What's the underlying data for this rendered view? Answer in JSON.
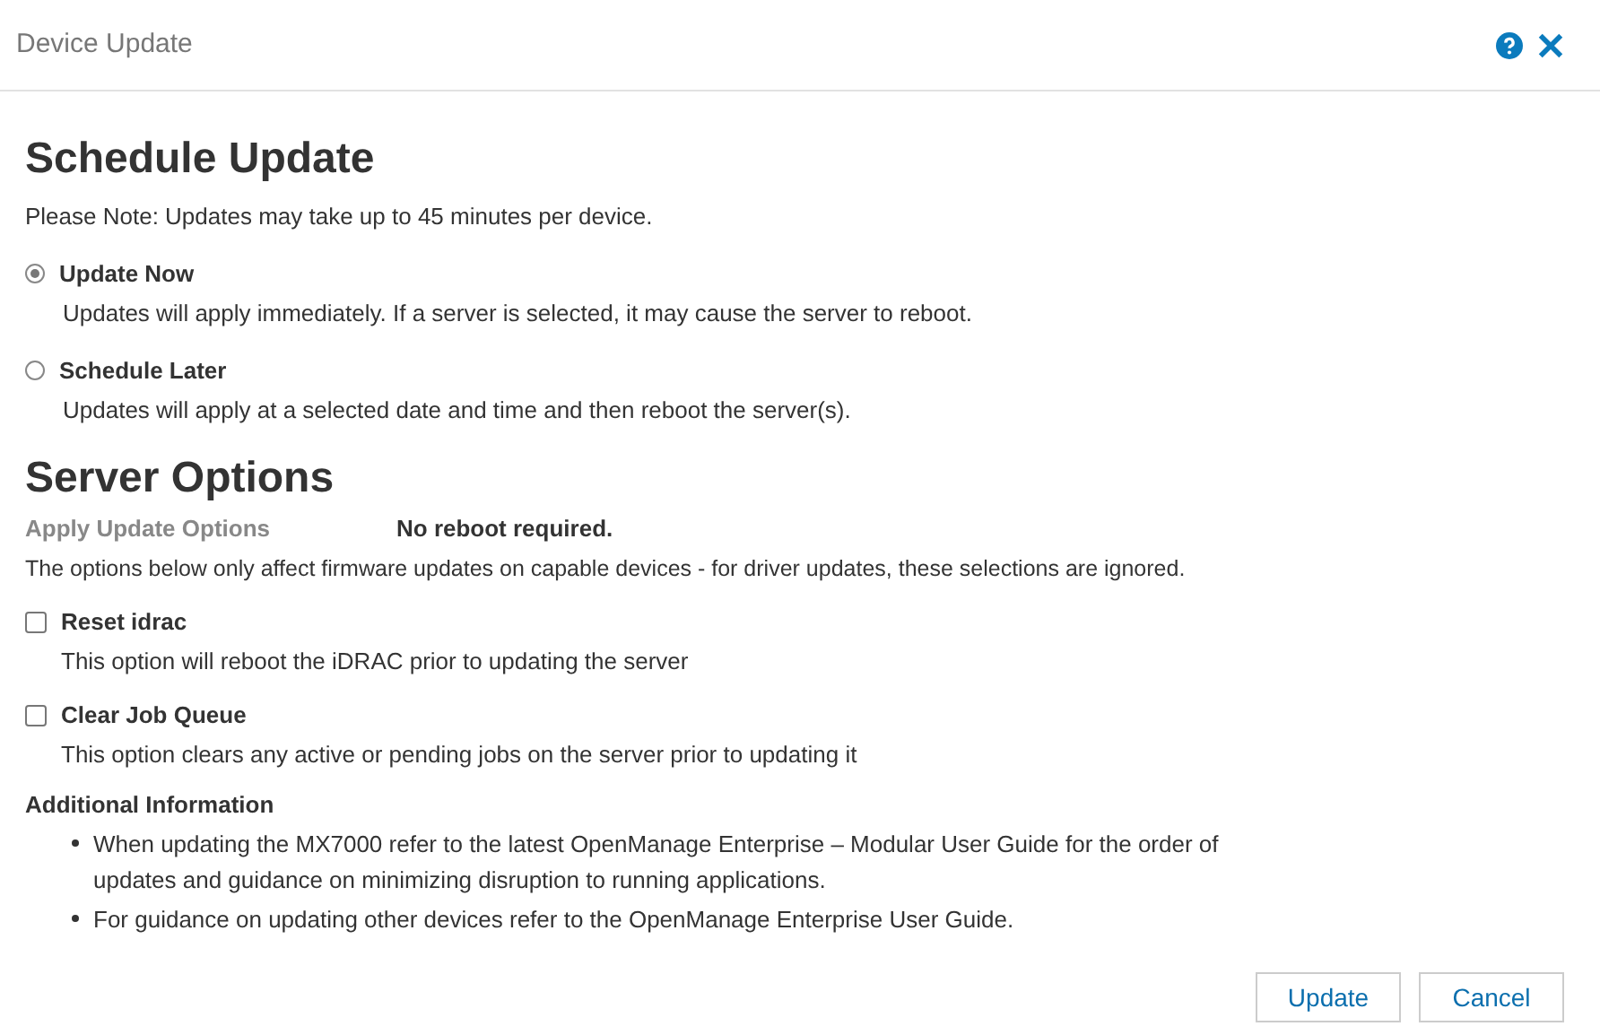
{
  "window": {
    "title": "Device Update"
  },
  "schedule": {
    "heading": "Schedule Update",
    "note": "Please Note: Updates may take up to 45 minutes per device.",
    "options": [
      {
        "label": "Update Now",
        "description": "Updates will apply immediately. If a server is selected, it may cause the server to reboot.",
        "selected": true
      },
      {
        "label": "Schedule Later",
        "description": "Updates will apply at a selected date and time and then reboot the server(s).",
        "selected": false
      }
    ]
  },
  "server_options": {
    "heading": "Server Options",
    "apply_label": "Apply Update Options",
    "apply_value": "No reboot required.",
    "note": "The options below only affect firmware updates on capable devices - for driver updates, these selections are ignored.",
    "checkboxes": [
      {
        "label": "Reset idrac",
        "description": "This option will reboot the iDRAC prior to updating the server",
        "checked": false
      },
      {
        "label": "Clear Job Queue",
        "description": "This option clears any active or pending jobs on the server prior to updating it",
        "checked": false
      }
    ]
  },
  "additional_info": {
    "heading": "Additional Information",
    "items": [
      "When updating the MX7000 refer to the latest OpenManage Enterprise – Modular User Guide for the order of updates and guidance on minimizing disruption to running applications.",
      "For guidance on updating other devices refer to the OpenManage Enterprise User Guide."
    ]
  },
  "buttons": [
    "Update",
    "Cancel"
  ]
}
